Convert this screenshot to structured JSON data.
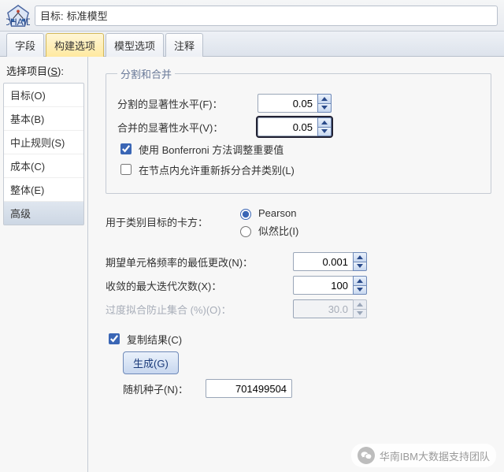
{
  "header": {
    "logo_text": "CHAID",
    "title_prefix": "目标:",
    "title_value": "标准模型"
  },
  "tabs": {
    "fields": "字段",
    "build": "构建选项",
    "model": "模型选项",
    "notes": "注释"
  },
  "left": {
    "title_pre": "选择项目(",
    "title_u": "S",
    "title_post": "):",
    "items": {
      "o": "目标(O)",
      "b": "基本(B)",
      "s": "中止规则(S)",
      "c": "成本(C)",
      "e": "整体(E)",
      "adv": "高级"
    }
  },
  "panel": {
    "group_title": "分割和合并",
    "split_label": "分割的显著性水平(F)：",
    "split_value": "0.05",
    "merge_label": "合并的显著性水平(V)：",
    "merge_value": "0.05",
    "bonf_label": "使用 Bonferroni 方法调整重要值",
    "resplit_label": "在节点内允许重新拆分合并类别(L)",
    "chisq_label": "用于类别目标的卡方：",
    "opt_pearson": "Pearson",
    "opt_lr": "似然比(I)",
    "minchg_label": "期望单元格频率的最低更改(N)：",
    "minchg_value": "0.001",
    "maxiter_label": "收敛的最大迭代次数(X)：",
    "maxiter_value": "100",
    "overfit_label": "过度拟合防止集合 (%)(O)：",
    "overfit_value": "30.0",
    "repl_label": "复制结果(C)",
    "gen_button": "生成(G)",
    "seed_label": "随机种子(N)：",
    "seed_value": "701499504"
  },
  "watermark": "华南IBM大数据支持团队"
}
